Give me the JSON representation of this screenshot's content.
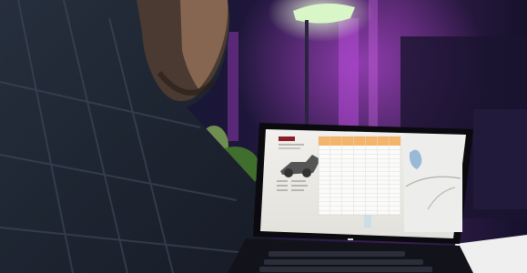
{
  "photo": {
    "subject": "man-at-laptop"
  },
  "screen_app": {
    "logo_text": "",
    "table_rows": 16,
    "table_cols": 7
  },
  "colors": {
    "lamp_glow": "#d9f6c9",
    "purple_light": "#b44ad6",
    "screen_bg": "#ecebe6",
    "table_header": "#f4b46a",
    "map_lake": "#9ab9d6"
  }
}
